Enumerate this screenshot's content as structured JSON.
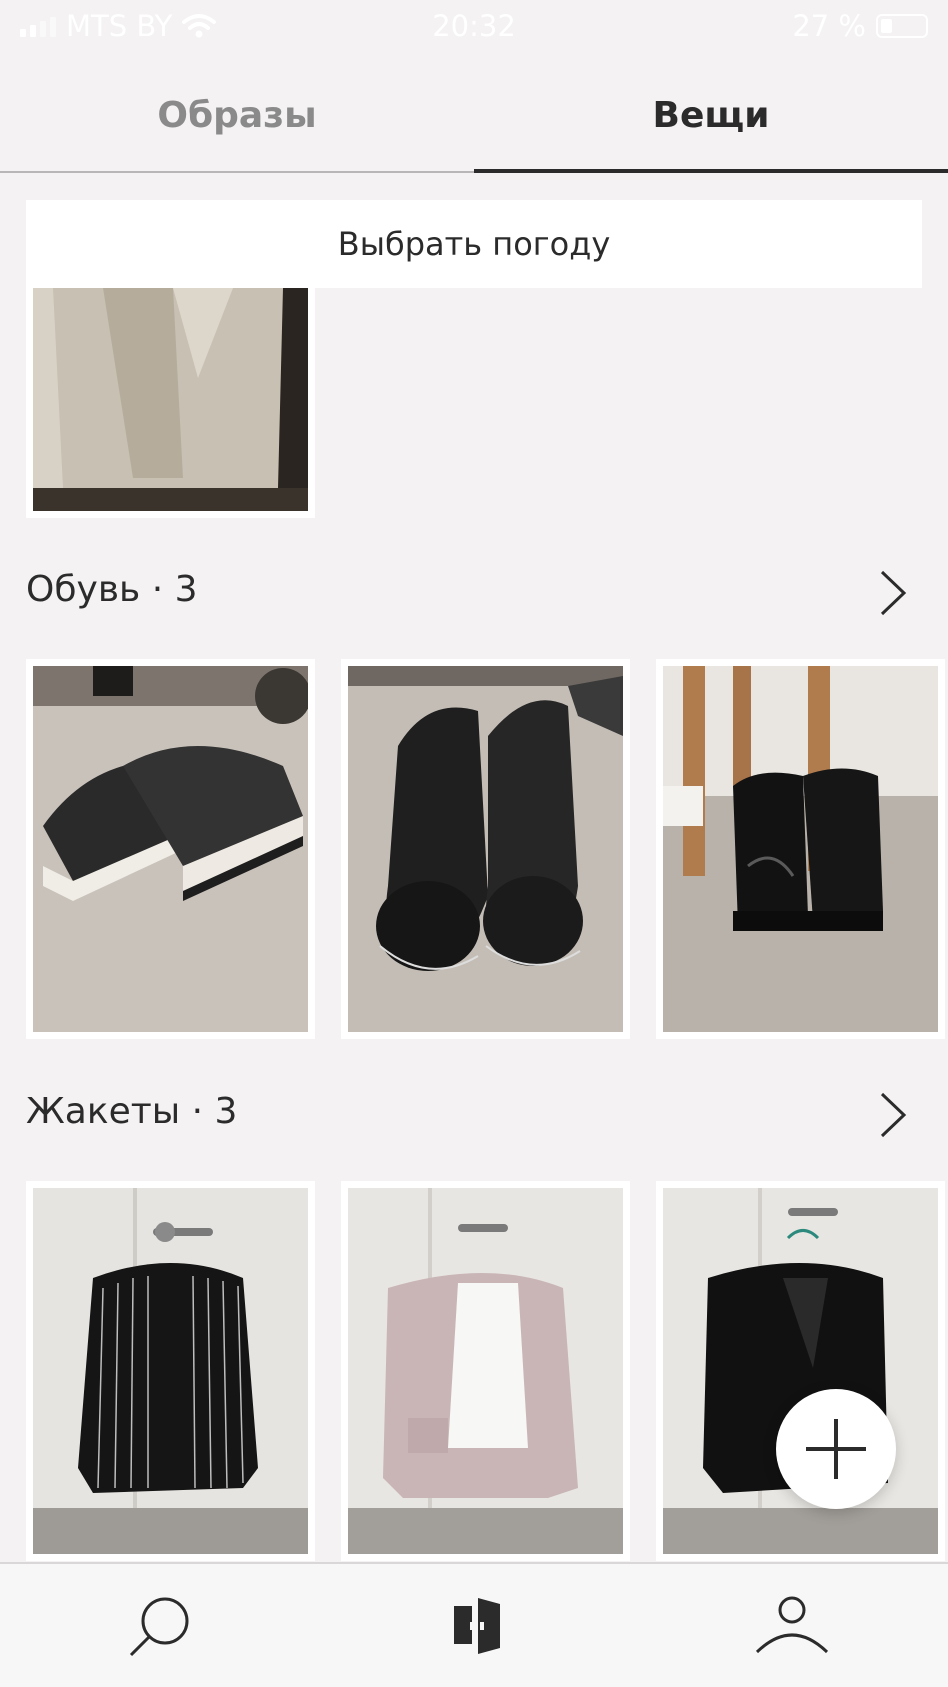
{
  "status_bar": {
    "carrier": "MTS BY",
    "time": "20:32",
    "battery": "27 %",
    "battery_level": 0.27
  },
  "tabs": [
    {
      "label": "Образы",
      "active": false
    },
    {
      "label": "Вещи",
      "active": true
    }
  ],
  "weather_button": {
    "label": "Выбрать погоду"
  },
  "sections": [
    {
      "title": "Обувь · 3",
      "items": [
        "sneakers",
        "leather-boots",
        "patent-boots"
      ]
    },
    {
      "title": "Жакеты · 3",
      "items": [
        "striped-blazer",
        "pink-blazer",
        "black-blazer"
      ]
    }
  ],
  "icons": {
    "tab_search": "search-icon",
    "tab_wardrobe": "wardrobe-icon",
    "tab_profile": "profile-icon",
    "add": "plus-icon",
    "next": "chevron-right-icon"
  },
  "colors": {
    "background": "#f4f2f2",
    "text": "#2b2b2b",
    "inactive_tab": "#8a8a8a",
    "card": "#ffffff"
  }
}
